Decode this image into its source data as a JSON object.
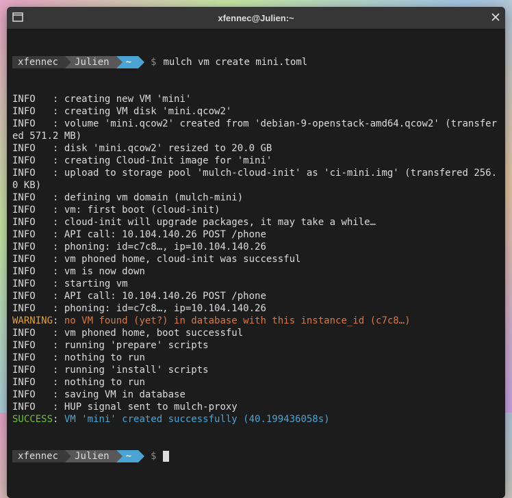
{
  "window": {
    "title": "xfennec@Julien:~",
    "menu_icon": "menu-icon",
    "close_icon": "close-icon"
  },
  "prompt": {
    "user": "xfennec",
    "host": "Julien",
    "path": "~",
    "symbol": "$"
  },
  "command": "mulch vm create mini.toml",
  "log": [
    {
      "level": "INFO",
      "msg": "creating new VM 'mini'"
    },
    {
      "level": "INFO",
      "msg": "creating VM disk 'mini.qcow2'"
    },
    {
      "level": "INFO",
      "msg": "volume 'mini.qcow2' created from 'debian-9-openstack-amd64.qcow2' (transfered 571.2 MB)"
    },
    {
      "level": "INFO",
      "msg": "disk 'mini.qcow2' resized to 20.0 GB"
    },
    {
      "level": "INFO",
      "msg": "creating Cloud-Init image for 'mini'"
    },
    {
      "level": "INFO",
      "msg": "upload to storage pool 'mulch-cloud-init' as 'ci-mini.img' (transfered 256.0 KB)"
    },
    {
      "level": "INFO",
      "msg": "defining vm domain (mulch-mini)"
    },
    {
      "level": "INFO",
      "msg": "vm: first boot (cloud-init)"
    },
    {
      "level": "INFO",
      "msg": "cloud-init will upgrade packages, it may take a while…"
    },
    {
      "level": "INFO",
      "msg": "API call: 10.104.140.26 POST /phone"
    },
    {
      "level": "INFO",
      "msg": "phoning: id=c7c8…, ip=10.104.140.26"
    },
    {
      "level": "INFO",
      "msg": "vm phoned home, cloud-init was successful"
    },
    {
      "level": "INFO",
      "msg": "vm is now down"
    },
    {
      "level": "INFO",
      "msg": "starting vm"
    },
    {
      "level": "INFO",
      "msg": "API call: 10.104.140.26 POST /phone"
    },
    {
      "level": "INFO",
      "msg": "phoning: id=c7c8…, ip=10.104.140.26"
    },
    {
      "level": "WARNING",
      "msg": "no VM found (yet?) in database with this instance_id (c7c8…)"
    },
    {
      "level": "INFO",
      "msg": "vm phoned home, boot successful"
    },
    {
      "level": "INFO",
      "msg": "running 'prepare' scripts"
    },
    {
      "level": "INFO",
      "msg": "nothing to run"
    },
    {
      "level": "INFO",
      "msg": "running 'install' scripts"
    },
    {
      "level": "INFO",
      "msg": "nothing to run"
    },
    {
      "level": "INFO",
      "msg": "saving VM in database"
    },
    {
      "level": "INFO",
      "msg": "HUP signal sent to mulch-proxy"
    },
    {
      "level": "SUCCESS",
      "msg": "VM 'mini' created successfully (40.199436058s)"
    }
  ]
}
